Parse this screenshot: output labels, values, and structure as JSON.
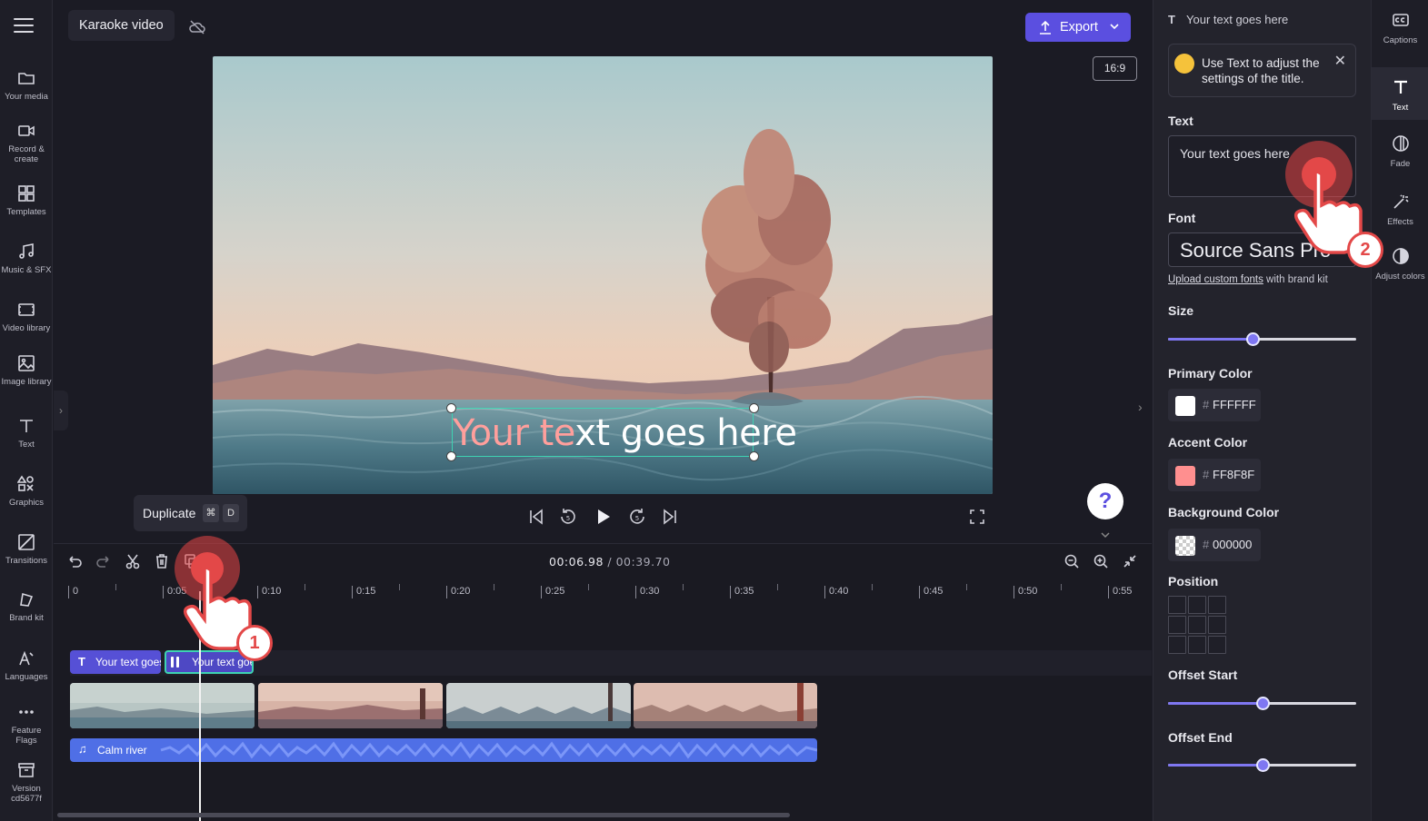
{
  "sidebar": {
    "items": [
      {
        "label": "Your media",
        "icon": "folder-icon"
      },
      {
        "label": "Record & create",
        "icon": "camera-icon"
      },
      {
        "label": "Templates",
        "icon": "templates-icon"
      },
      {
        "label": "Music & SFX",
        "icon": "music-icon"
      },
      {
        "label": "Video library",
        "icon": "film-icon"
      },
      {
        "label": "Image library",
        "icon": "image-icon"
      },
      {
        "label": "Text",
        "icon": "text-icon"
      },
      {
        "label": "Graphics",
        "icon": "graphics-icon"
      },
      {
        "label": "Transitions",
        "icon": "transitions-icon"
      },
      {
        "label": "Brand kit",
        "icon": "brand-kit-icon"
      },
      {
        "label": "Languages",
        "icon": "languages-icon"
      },
      {
        "label": "Feature Flags",
        "icon": "more-icon"
      },
      {
        "label": "Version cd5677f",
        "icon": "archive-icon"
      }
    ]
  },
  "topbar": {
    "project_name": "Karaoke video",
    "export_label": "Export"
  },
  "preview": {
    "aspect_ratio": "16:9",
    "title_text_part1": "Your te",
    "title_text_part2": "xt goes here",
    "primary_color": "#FFFFFF",
    "accent_color": "#FF8F8F"
  },
  "tooltip": {
    "label": "Duplicate",
    "key1": "⌘",
    "key2": "D"
  },
  "timeline": {
    "current_time": "00:06.98",
    "total_time": "/ 00:39.70",
    "ruler_labels": [
      "0",
      "0:05",
      "0:10",
      "0:15",
      "0:20",
      "0:25",
      "0:30",
      "0:35",
      "0:40",
      "0:45",
      "0:50",
      "0:55"
    ],
    "text_clip_1": "Your text goes here",
    "text_clip_2": "Your text goes here",
    "audio_clip": "Calm river"
  },
  "props": {
    "header": "Your text goes here",
    "hint": "Use Text to adjust the settings of the title.",
    "text_label": "Text",
    "text_value": "Your text goes here",
    "font_label": "Font",
    "font_value": "Source Sans Pro",
    "upload_link": "Upload custom fonts",
    "upload_suffix": "with brand kit",
    "size_label": "Size",
    "size_value": 0.45,
    "primary_label": "Primary Color",
    "primary_hex": "FFFFFF",
    "accent_label": "Accent Color",
    "accent_hex": "FF8F8F",
    "background_label": "Background Color",
    "background_hex": "000000",
    "position_label": "Position",
    "offset_start_label": "Offset Start",
    "offset_start_value": 0.5,
    "offset_end_label": "Offset End",
    "offset_end_value": 0.5
  },
  "tabs": [
    {
      "label": "Captions",
      "icon": "captions-icon"
    },
    {
      "label": "Text",
      "icon": "text-icon",
      "active": true
    },
    {
      "label": "Fade",
      "icon": "fade-icon"
    },
    {
      "label": "Effects",
      "icon": "effects-icon"
    },
    {
      "label": "Adjust colors",
      "icon": "adjust-colors-icon"
    }
  ],
  "annotations": {
    "step1": "1",
    "step2": "2"
  },
  "colors": {
    "accent": "#5b4fe0",
    "selection": "#3ed3b2",
    "annotation": "#e34848"
  }
}
